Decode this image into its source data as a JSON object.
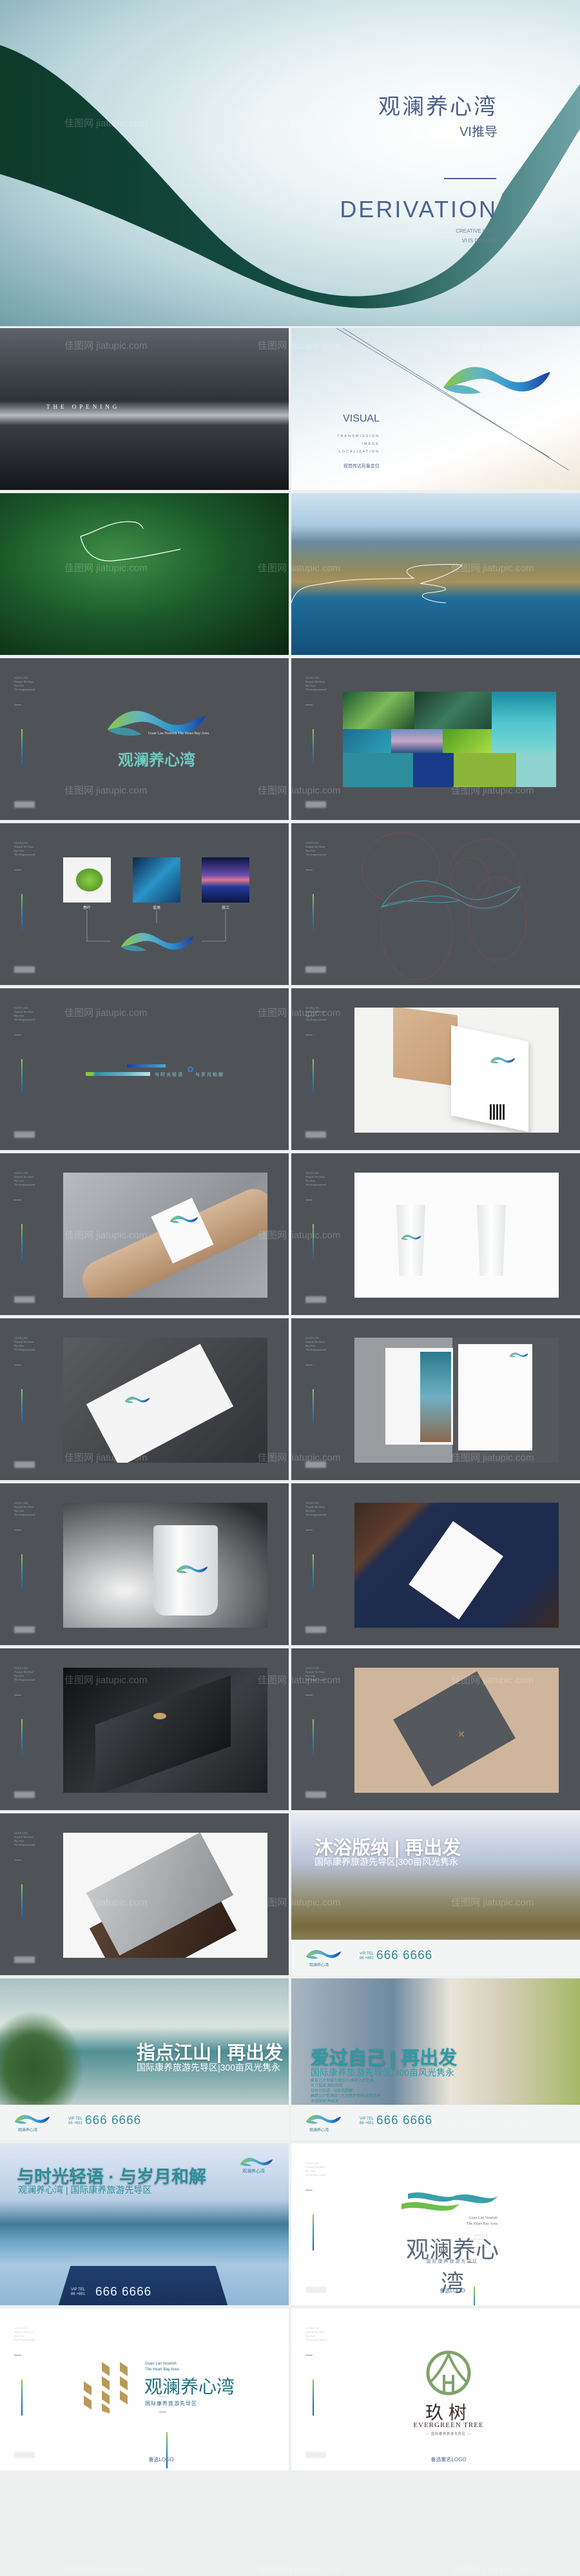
{
  "watermark": "佳图网 jiatupic.com",
  "colors": {
    "gray_bg": "#4f5358",
    "title_blue": "#4a5f8a",
    "teal": "#2a8d9a",
    "logo_green": "#8cc63f",
    "logo_blue": "#1d4fa8",
    "gold": "#b99a5b",
    "evergreen": "#7fa36b"
  },
  "hero": {
    "title": "观澜养心湾",
    "subtitle": "VI推导",
    "heading": "DERIVATION",
    "tag1": "CREATIVE LOGO",
    "tag2": "VI IS DERIVED"
  },
  "sidebar": {
    "lines": [
      "GUAN LAN",
      "Nourish The Heart",
      "Bay Area",
      "The design proposal"
    ]
  },
  "opening": {
    "text": "THE OPENING"
  },
  "visual": {
    "heading": "VISUAL",
    "lines": [
      "TRANSMISSION",
      "IMAGE",
      "LOCALIZATION"
    ],
    "cn": "视觉传达形象定位"
  },
  "logo_slide": {
    "en": "Guan Lan Nourish The Heart Bay Area",
    "cn": "观澜养心湾"
  },
  "moodboard": {
    "swatches": [
      "#2e8d9c",
      "#1a3a8a",
      "#8ab43a",
      "#8fd3cf"
    ]
  },
  "inspiration": {
    "labels": [
      "春叶",
      "雀尾",
      "夜江"
    ]
  },
  "slogan_slide": {
    "left": "与时光轻语",
    "right": "与岁月和解"
  },
  "posters": [
    {
      "title": "沐浴版纳 | 再出发",
      "sub": "国际康养旅游先导区|300亩风光隽永",
      "tel_label": "VIP TEL",
      "tel_code": "86 +691",
      "tel": "666 6666"
    },
    {
      "title": "指点江山 | 再出发",
      "sub": "国际康养旅游先导区|300亩风光隽永",
      "tel_label": "VIP TEL",
      "tel_code": "86 +691",
      "tel": "666 6666"
    },
    {
      "title": "爱过自己 | 再出发",
      "sub": "国际康养旅游先导区|300亩风光隽永",
      "body": [
        "爱自己才有能力爱别人,休养之后生息,",
        "东方智慧,国际风采,",
        "与时光轻语 · 与岁月和解",
        "高精尖疗愈酒店 | 九大医疗专科|适老适养",
        "沐浴版纳 再出发"
      ],
      "tel_label": "VIP TEL",
      "tel_code": "86 +691",
      "tel": "666 6666"
    },
    {
      "title": "与时光轻语 · 与岁月和解",
      "sub": "观澜养心湾 | 国际康养旅游先导区",
      "tel_label": "VIP TEL",
      "tel_code": "86 +691",
      "tel": "666 6666"
    }
  ],
  "logo_alt1": {
    "en1": "Guan Lan Nourish",
    "en2": "The Heart Bay Area",
    "cn": "观澜养心湾",
    "sub": "国际康养旅游先导区",
    "caption": "备选LOGO"
  },
  "logo_alt2": {
    "en1": "Guan Lan Nourish",
    "en2": "The Heart Bay Area",
    "cn": "观澜养心湾",
    "sub": "国际康养旅游先导区",
    "caption": "备选LOGO"
  },
  "logo_alt3": {
    "cn": "玖树",
    "en": "EVERGREEN TREE",
    "sub": "— 国际康养旅游先导区 —",
    "caption": "备选案名LOGO"
  },
  "mini_logo": {
    "cn": "观澜养心湾"
  }
}
